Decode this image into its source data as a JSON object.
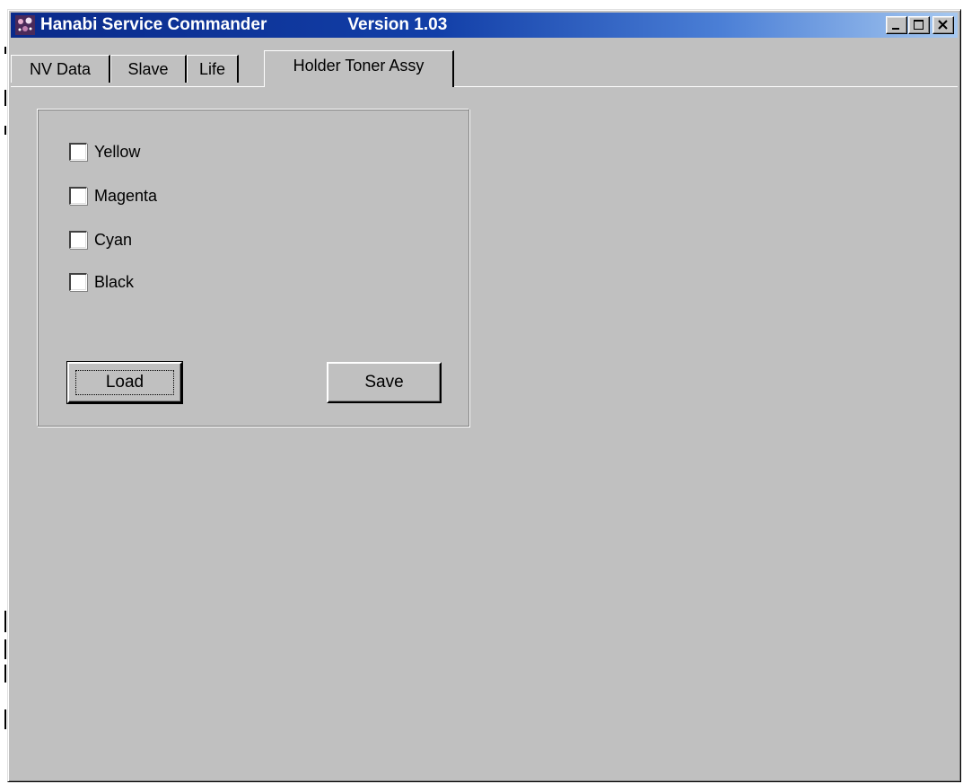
{
  "window": {
    "title": "Hanabi Service Commander",
    "version": "Version 1.03",
    "controls": {
      "minimize": "minimize-icon",
      "maximize": "maximize-icon",
      "close": "close-icon"
    }
  },
  "tabs": [
    {
      "label": "NV Data",
      "active": false
    },
    {
      "label": "Slave",
      "active": false
    },
    {
      "label": "Life",
      "active": false
    },
    {
      "label": "Holder Toner Assy",
      "active": true
    }
  ],
  "panel": {
    "checkboxes": [
      {
        "label": "Yellow",
        "checked": false
      },
      {
        "label": "Magenta",
        "checked": false
      },
      {
        "label": "Cyan",
        "checked": false
      },
      {
        "label": "Black",
        "checked": false
      }
    ],
    "load_label": "Load",
    "save_label": "Save"
  },
  "colors": {
    "titlebar_start": "#0a2a8a",
    "titlebar_end": "#a6c8f0",
    "face": "#c0c0c0"
  }
}
